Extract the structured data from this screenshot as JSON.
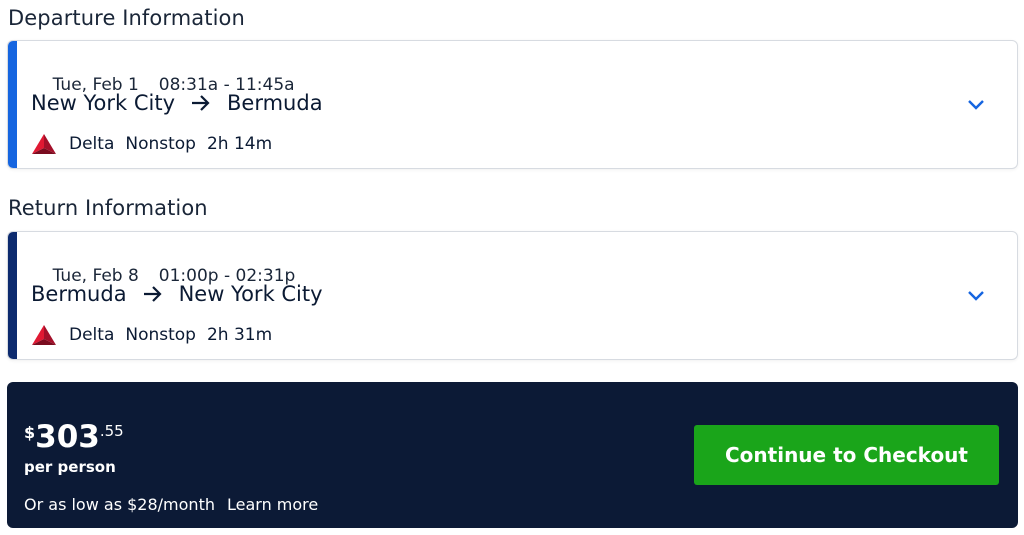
{
  "departure": {
    "heading": "Departure Information",
    "date": "Tue, Feb 1",
    "time": "08:31a - 11:45a",
    "origin": "New York City",
    "destination": "Bermuda",
    "airline": "Delta",
    "stops": "Nonstop",
    "duration": "2h 14m",
    "accent_color": "#1565e0"
  },
  "return": {
    "heading": "Return Information",
    "date": "Tue, Feb 8",
    "time": "01:00p - 02:31p",
    "origin": "Bermuda",
    "destination": "New York City",
    "airline": "Delta",
    "stops": "Nonstop",
    "duration": "2h 31m",
    "accent_color": "#0c2a6e"
  },
  "pricing": {
    "currency_symbol": "$",
    "dollars": "303",
    "cents": ".55",
    "per_person": "per person",
    "financing": "Or as low as $28/month",
    "learn_more": "Learn more",
    "checkout_label": "Continue to Checkout",
    "panel_color": "#0c1a36",
    "button_color": "#1aa51a"
  },
  "icons": {
    "airline_logo": "delta-logo-icon",
    "route_arrow": "arrow-right-icon",
    "expand": "chevron-down-icon"
  }
}
